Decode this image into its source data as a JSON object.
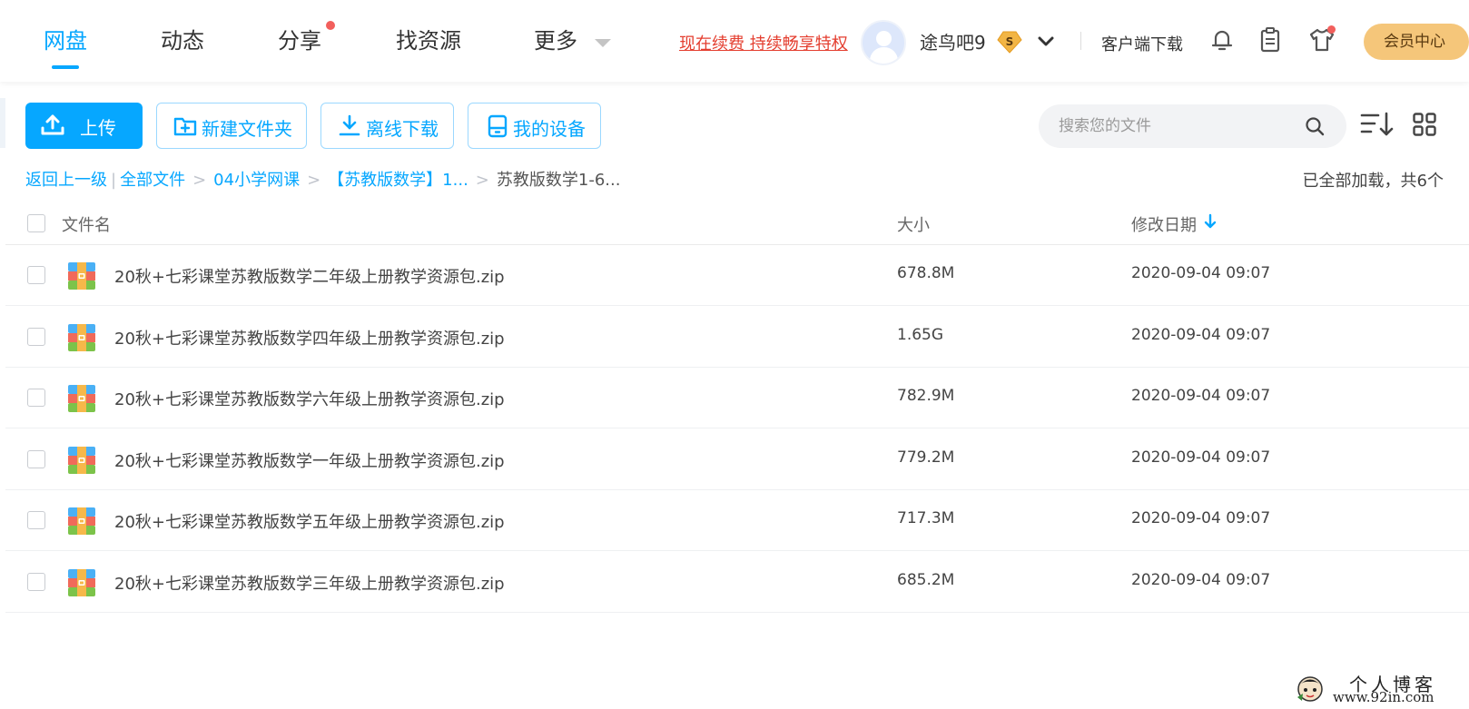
{
  "nav": {
    "items": [
      {
        "label": "网盘",
        "active": true
      },
      {
        "label": "动态",
        "active": false
      },
      {
        "label": "分享",
        "active": false,
        "badge_dot": true
      },
      {
        "label": "找资源",
        "active": false
      },
      {
        "label": "更多",
        "active": false
      }
    ],
    "renew_link": "现在续费 持续畅享特权",
    "username": "途鸟吧9",
    "svip_badge": "S",
    "client_download": "客户端下载",
    "member_center": "会员中心"
  },
  "toolbar": {
    "upload": "上传",
    "new_folder": "新建文件夹",
    "offline_download": "离线下载",
    "my_devices": "我的设备",
    "search_placeholder": "搜索您的文件"
  },
  "breadcrumb": {
    "back": "返回上一级",
    "items": [
      "全部文件",
      "04小学网课",
      "【苏教版数学】1..."
    ],
    "current": "苏教版数学1-6...",
    "status": "已全部加载，共6个"
  },
  "table": {
    "headers": {
      "name": "文件名",
      "size": "大小",
      "date": "修改日期"
    },
    "rows": [
      {
        "name": "20秋+七彩课堂苏教版数学二年级上册教学资源包.zip",
        "size": "678.8M",
        "date": "2020-09-04 09:07"
      },
      {
        "name": "20秋+七彩课堂苏教版数学四年级上册教学资源包.zip",
        "size": "1.65G",
        "date": "2020-09-04 09:07"
      },
      {
        "name": "20秋+七彩课堂苏教版数学六年级上册教学资源包.zip",
        "size": "782.9M",
        "date": "2020-09-04 09:07"
      },
      {
        "name": "20秋+七彩课堂苏教版数学一年级上册教学资源包.zip",
        "size": "779.2M",
        "date": "2020-09-04 09:07"
      },
      {
        "name": "20秋+七彩课堂苏教版数学五年级上册教学资源包.zip",
        "size": "717.3M",
        "date": "2020-09-04 09:07"
      },
      {
        "name": "20秋+七彩课堂苏教版数学三年级上册教学资源包.zip",
        "size": "685.2M",
        "date": "2020-09-04 09:07"
      }
    ]
  },
  "watermark": {
    "line1": "个人博客",
    "line2": "www.92in.com"
  },
  "colors": {
    "accent": "#06a7ff",
    "renew": "#e43e2f",
    "member": "#f5c67a",
    "dot": "#f25f5c"
  }
}
